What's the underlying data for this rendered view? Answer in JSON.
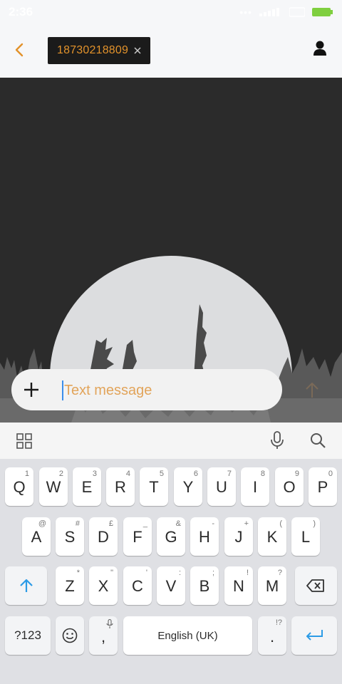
{
  "status_bar": {
    "time": "2:36",
    "dots": "•••"
  },
  "header": {
    "recipient_number": "18730218809"
  },
  "compose": {
    "placeholder": "Text message"
  },
  "keyboard": {
    "row1": [
      {
        "key": "Q",
        "hint": "1"
      },
      {
        "key": "W",
        "hint": "2"
      },
      {
        "key": "E",
        "hint": "3"
      },
      {
        "key": "R",
        "hint": "4"
      },
      {
        "key": "T",
        "hint": "5"
      },
      {
        "key": "Y",
        "hint": "6"
      },
      {
        "key": "U",
        "hint": "7"
      },
      {
        "key": "I",
        "hint": "8"
      },
      {
        "key": "O",
        "hint": "9"
      },
      {
        "key": "P",
        "hint": "0"
      }
    ],
    "row2": [
      {
        "key": "A",
        "hint": "@"
      },
      {
        "key": "S",
        "hint": "#"
      },
      {
        "key": "D",
        "hint": "£"
      },
      {
        "key": "F",
        "hint": "_"
      },
      {
        "key": "G",
        "hint": "&"
      },
      {
        "key": "H",
        "hint": "-"
      },
      {
        "key": "J",
        "hint": "+"
      },
      {
        "key": "K",
        "hint": "("
      },
      {
        "key": "L",
        "hint": ")"
      }
    ],
    "row3": [
      {
        "key": "Z",
        "hint": "*"
      },
      {
        "key": "X",
        "hint": "\""
      },
      {
        "key": "C",
        "hint": "'"
      },
      {
        "key": "V",
        "hint": ":"
      },
      {
        "key": "B",
        "hint": ";"
      },
      {
        "key": "N",
        "hint": "!"
      },
      {
        "key": "M",
        "hint": "?"
      }
    ],
    "symbols_label": "?123",
    "comma_label": ",",
    "space_label": "English (UK)",
    "period_label": ".",
    "period_hint": "!?"
  },
  "colors": {
    "accent": "#e2922b",
    "key_blue": "#2b9be6"
  }
}
